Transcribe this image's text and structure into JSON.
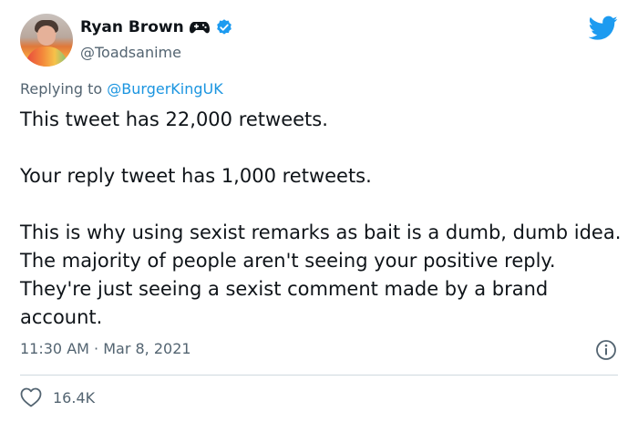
{
  "author": {
    "display_name": "Ryan Brown",
    "handle": "@Toadsanime",
    "badges": [
      "gamepad-icon",
      "verified-icon"
    ]
  },
  "reply_context": {
    "prefix": "Replying to",
    "mention": "@BurgerKingUK"
  },
  "tweet": {
    "paragraphs": [
      "This tweet has 22,000 retweets.",
      "Your reply tweet has 1,000 retweets.",
      "This is why using sexist remarks as bait is a dumb, dumb idea. The majority of people aren't seeing your positive reply. They're just seeing a sexist comment made by a brand account."
    ],
    "timestamp": "11:30 AM · Mar 8, 2021"
  },
  "engagement": {
    "likes": "16.4K"
  },
  "colors": {
    "brand": "#1d9bf0",
    "mention": "#1b95e0",
    "secondary_text": "#536471",
    "divider": "#cfd9de"
  },
  "icons": [
    "twitter-logo-icon",
    "info-icon",
    "heart-icon"
  ]
}
